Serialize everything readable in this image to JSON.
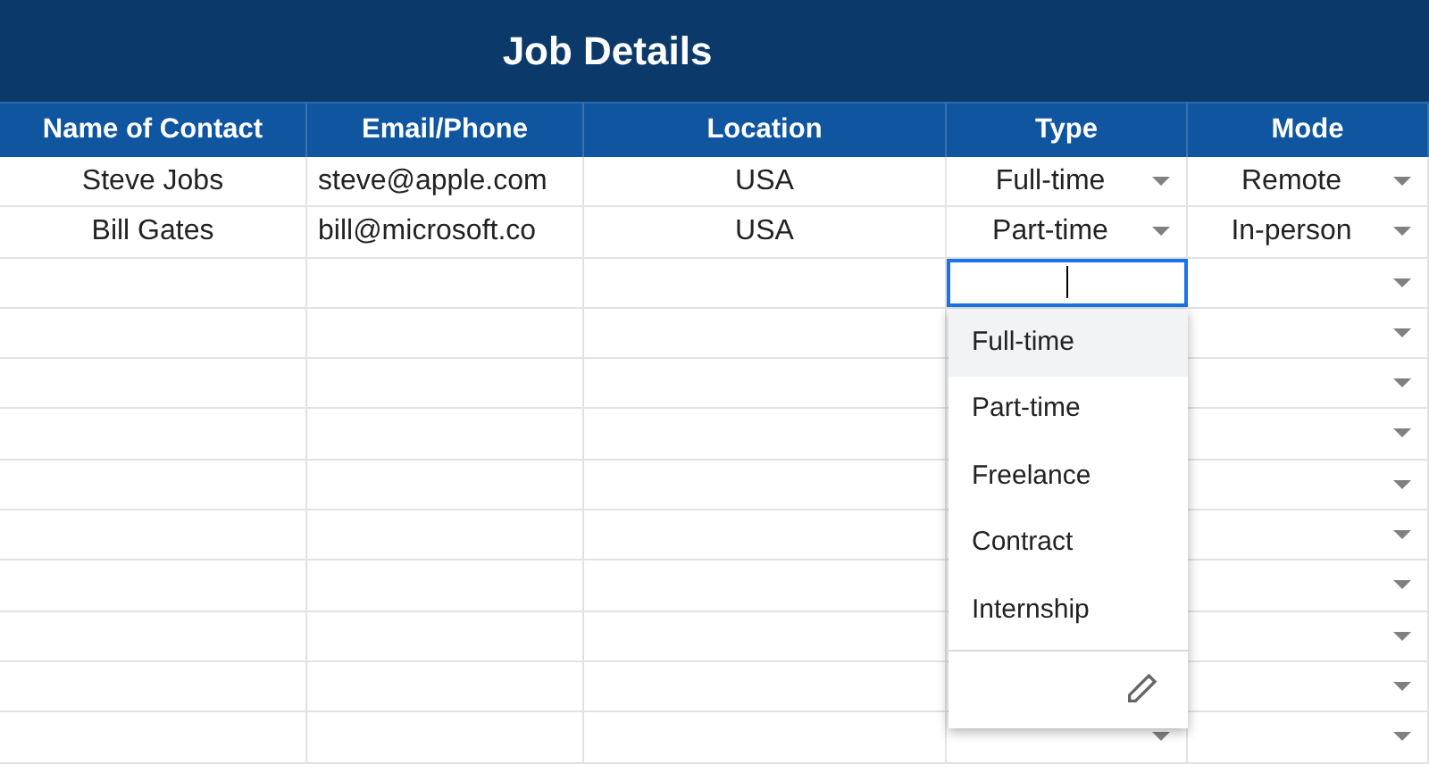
{
  "title": "Job Details",
  "columns": [
    {
      "label": "Name of Contact",
      "kind": "text"
    },
    {
      "label": "Email/Phone",
      "kind": "text"
    },
    {
      "label": "Location",
      "kind": "text"
    },
    {
      "label": "Type",
      "kind": "dropdown"
    },
    {
      "label": "Mode",
      "kind": "dropdown"
    }
  ],
  "rows": [
    {
      "kind": "filled",
      "cells": [
        "Steve Jobs",
        "steve@apple.com",
        "USA",
        "Full-time",
        "Remote"
      ]
    },
    {
      "kind": "filled",
      "cells": [
        "Bill Gates",
        "bill@microsoft.co",
        "USA",
        "Part-time",
        "In-person"
      ]
    },
    {
      "kind": "editing"
    },
    {
      "kind": "blank"
    },
    {
      "kind": "blank"
    },
    {
      "kind": "blank"
    },
    {
      "kind": "blank"
    },
    {
      "kind": "blank"
    },
    {
      "kind": "blank"
    },
    {
      "kind": "blank"
    },
    {
      "kind": "blank"
    },
    {
      "kind": "blank"
    }
  ],
  "dropdown": {
    "options": [
      {
        "label": "Full-time",
        "selected": true
      },
      {
        "label": "Part-time",
        "selected": false
      },
      {
        "label": "Freelance",
        "selected": false
      },
      {
        "label": "Contract",
        "selected": false
      },
      {
        "label": "Internship",
        "selected": false
      }
    ]
  }
}
